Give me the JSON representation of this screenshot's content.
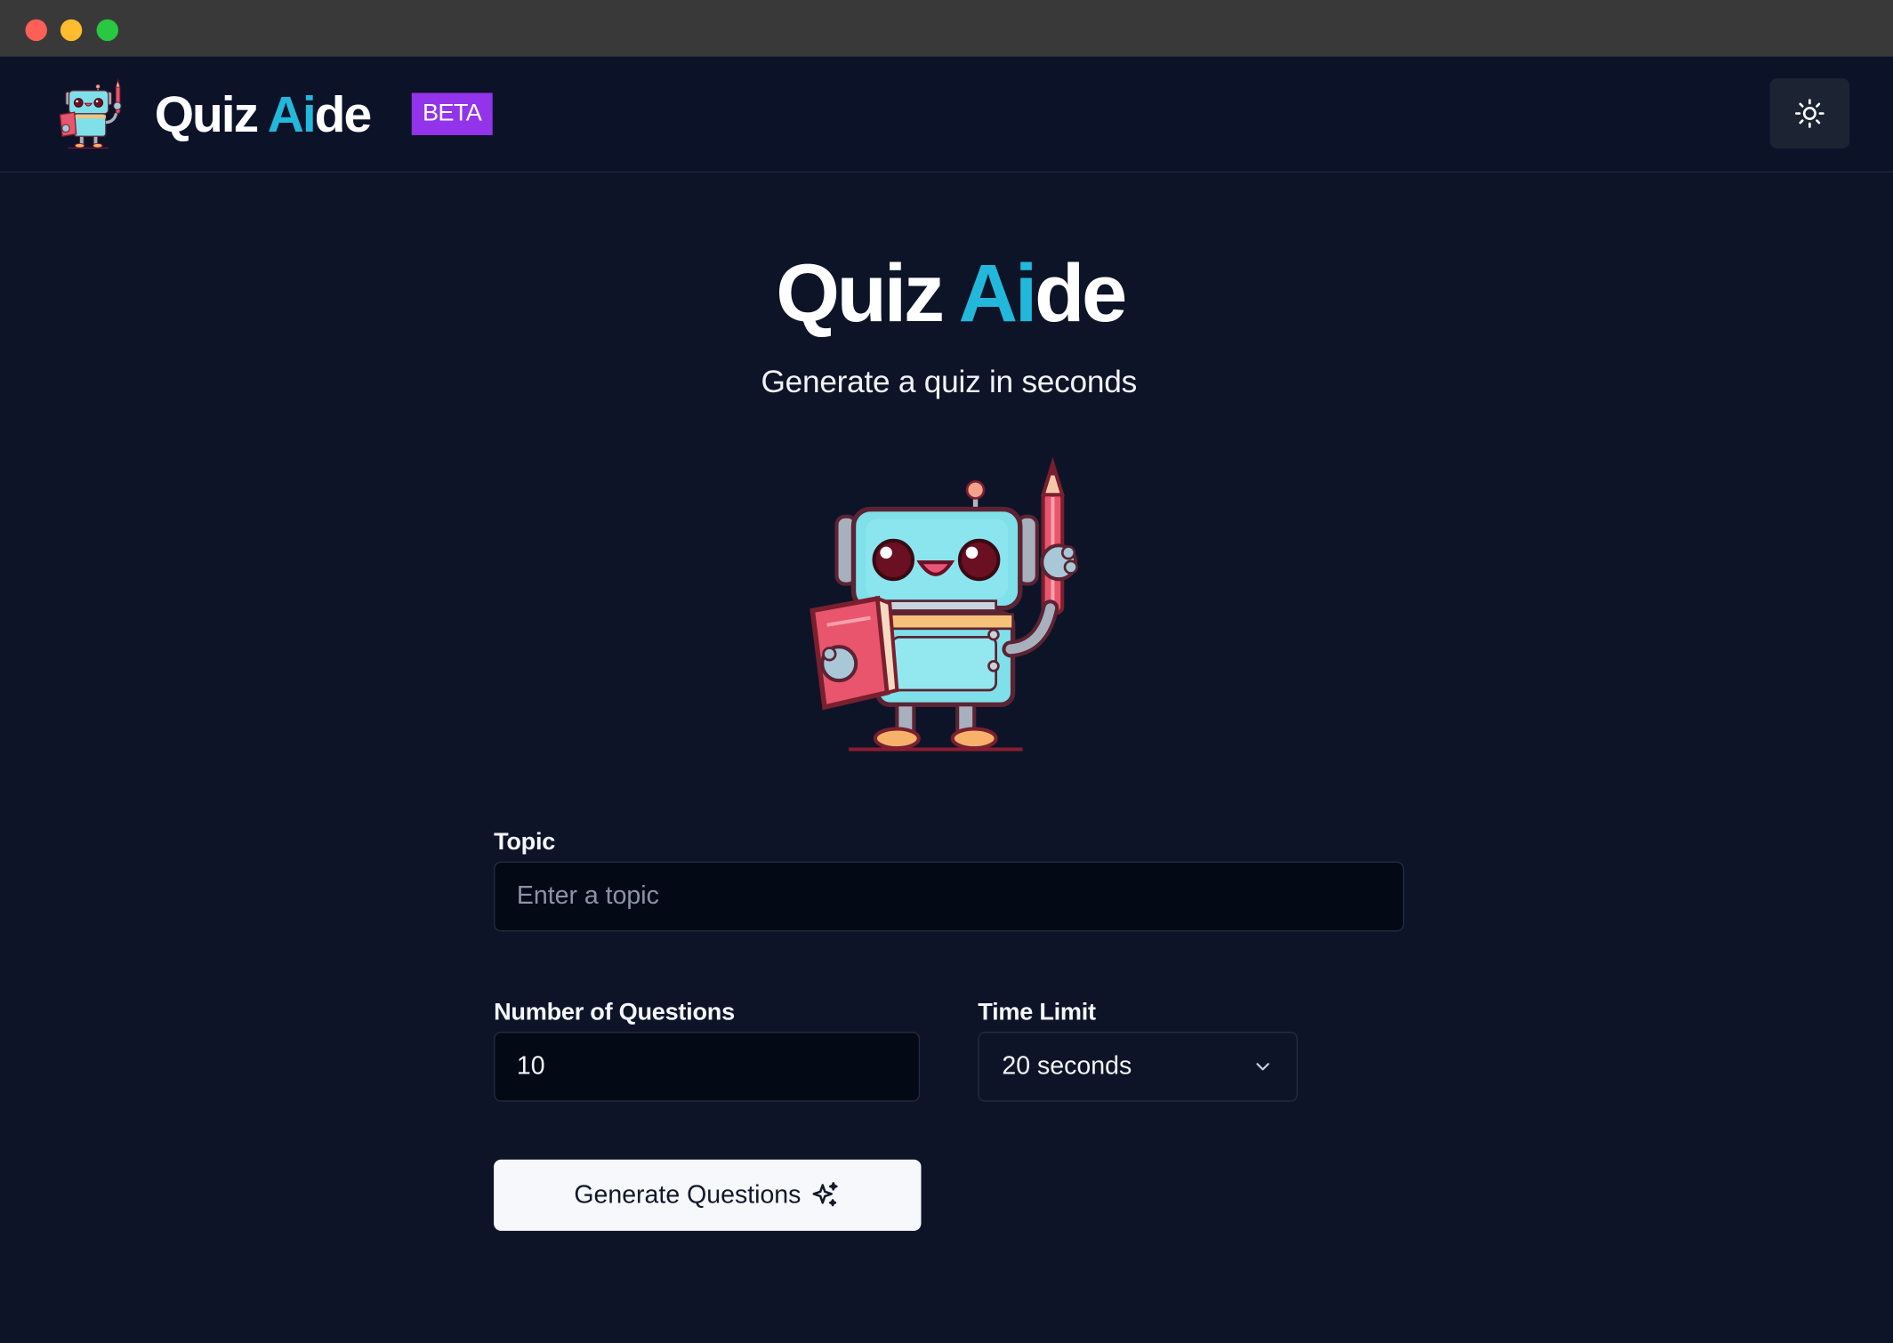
{
  "brand": {
    "name_part1": "Quiz ",
    "name_accent": "Ai",
    "name_part2": "de",
    "badge": "BETA",
    "accent_color": "#22b8dc",
    "badge_color": "#9333ea"
  },
  "header": {
    "theme_toggle_icon": "sun-icon"
  },
  "hero": {
    "title_part1": "Quiz ",
    "title_accent": "Ai",
    "title_part2": "de",
    "subtitle": "Generate a quiz in seconds",
    "mascot_icon": "robot-mascot"
  },
  "form": {
    "topic": {
      "label": "Topic",
      "value": "",
      "placeholder": "Enter a topic"
    },
    "num_questions": {
      "label": "Number of Questions",
      "value": "10"
    },
    "time_limit": {
      "label": "Time Limit",
      "selected": "20 seconds",
      "icon": "chevron-down-icon"
    },
    "generate": {
      "label": "Generate Questions",
      "icon": "sparkles-icon"
    }
  }
}
